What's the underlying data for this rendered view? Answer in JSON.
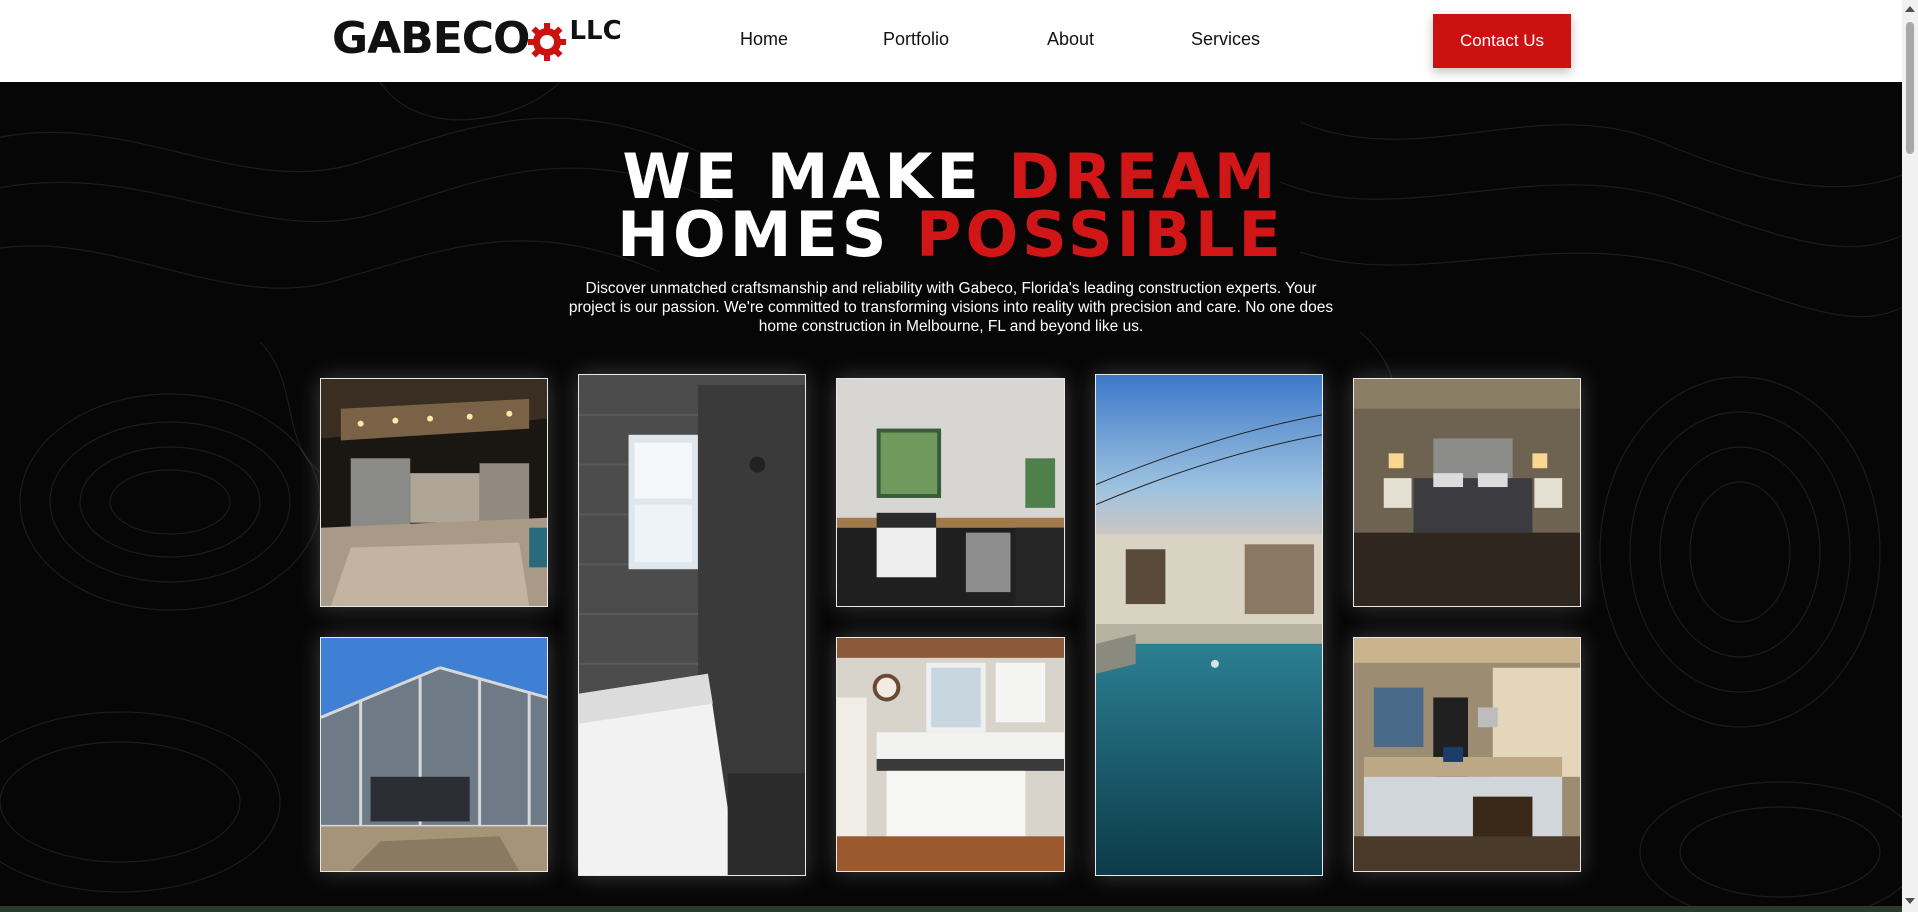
{
  "brand": {
    "name": "GABECO",
    "suffix": "LLC",
    "accent": "#cc1111"
  },
  "nav": {
    "links": [
      {
        "label": "Home"
      },
      {
        "label": "Portfolio"
      },
      {
        "label": "About"
      },
      {
        "label": "Services"
      }
    ],
    "cta_label": "Contact Us"
  },
  "hero": {
    "headline_line1_white": "WE MAKE ",
    "headline_line1_red": "DREAM",
    "headline_line2_white": "HOMES ",
    "headline_line2_red": "POSSIBLE",
    "description": "Discover unmatched craftsmanship and reliability with Gabeco, Florida's leading construction experts. Your project is our passion. We're committed to transforming visions into reality with precision and care. No one does home construction in Melbourne, FL and beyond like us."
  },
  "gallery": {
    "images": [
      {
        "name": "outdoor-kitchen-pavilion-photo"
      },
      {
        "name": "bathroom-shower-tub-photo"
      },
      {
        "name": "kitchen-sink-window-photo"
      },
      {
        "name": "pool-house-dusk-photo"
      },
      {
        "name": "bedroom-photo"
      },
      {
        "name": "screen-enclosure-photo"
      },
      {
        "name": "kitchen-cabinets-photo"
      },
      {
        "name": "kitchen-island-photo"
      }
    ]
  },
  "colors": {
    "hero_bg": "#060606",
    "headline_red": "#d01616",
    "nav_bg": "#ffffff"
  }
}
